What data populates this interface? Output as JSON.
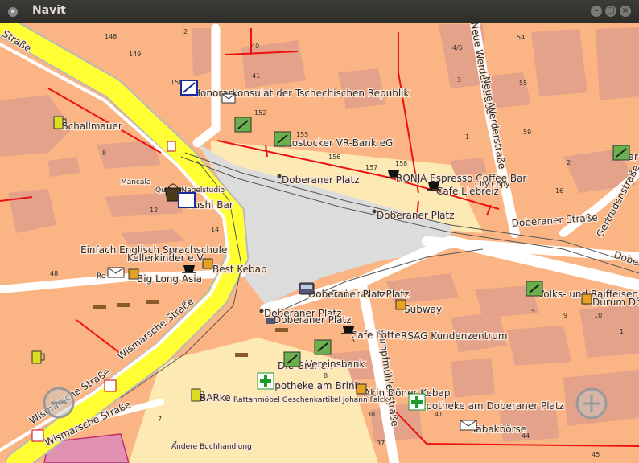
{
  "window": {
    "title": "Navit"
  },
  "labels": {
    "honorar": "Honorarkonsulat der Tschechischen Republik",
    "schallmauer": "Schallmauer",
    "rostocker": "Rostocker VR-Bank eG",
    "doberaner_platz_1": "Doberaner Platz",
    "doberaner_platz_2": "Doberaner Platz",
    "doberaner_platz_3": "Doberaner Platz",
    "doberaner_platz_4": "Doberaner Platz",
    "doberaner_platz_5": "Doberaner Platz",
    "doberaner_platz_6": "Doberaner Platz",
    "ronja": "RONJA Espresso Coffee Bar",
    "cafe_liebreiz": "Cafe Liebreiz",
    "city_copy": "City Copy",
    "mancala": "Mancala",
    "nagelstudio": "Queen Nagelstudio",
    "sushi_bar": "Sushi Bar",
    "englisch": "Einfach Englisch Sprachschule",
    "kellerkinder": "Kellerkinder e.V.",
    "best_kebap": "Best Kebap",
    "big_long_asia": "Big Long Asia",
    "rosa": "Ro",
    "subway": "Subway",
    "cafe_lotte": "Cafe Lotte",
    "rsag": "RSAG Kundenzentrum",
    "volksbank": "Volks- und Raiffeisenbank",
    "doener_bude": "Dürum Döner",
    "gruenen": "Die Grünen",
    "reinsbank": "Vereinsbank",
    "apotheke_brink": "Apotheke am Brink",
    "akin": "Akin Döner Kebap",
    "apotheke_platz": "Apotheke am Doberaner Platz",
    "tabakboerse": "Tabakbörse",
    "barke": "BARke",
    "rattanmoebel": "Rattanmöbel Geschenkartikel Johann Falck",
    "buchhandlung": "Andere Buchhandlung",
    "sarb": "Sar"
  },
  "streets": {
    "strasse_nw": "Straße",
    "neue_werder_1": "Neue Werderstraße",
    "neue_werder_2": "Neue Werderstraße",
    "doberaner_strasse": "Doberaner Straße",
    "doberaner_strasse_2": "Dobe",
    "gertruden": "Gertrudenstraße",
    "wismarsche_1": "Wismarsche Straße",
    "wismarsche_2": "Wismarsche Straße",
    "wismarsche_3": "Wismarsche Straße",
    "wismarsche_4": "Wismarsche Straße",
    "schoenfeldt": "Schröderstraße",
    "sumpfmuehle": "Sumpfmühlenstraße"
  },
  "house_numbers": {
    "n148": "148",
    "n149": "149",
    "n150": "150",
    "n2a": "2",
    "n40": "40",
    "n41": "41",
    "n152": "152",
    "n155": "155",
    "n156": "156",
    "n157": "157",
    "n158": "158",
    "n4_5": "4/5",
    "n3": "3",
    "n1": "1",
    "n54": "54",
    "n55": "55",
    "n59": "59",
    "n2b": "2",
    "n8": "8",
    "n12": "12",
    "n14": "14",
    "n48": "48",
    "n16": "16",
    "n6": "6",
    "n5": "5",
    "n9": "9",
    "n10": "10",
    "n1b": "1",
    "n3b": "3",
    "n7": "7",
    "n8b": "8",
    "n38": "38",
    "n37": "37",
    "n41b": "41",
    "n7b": "7",
    "n44": "44",
    "n45": "45"
  },
  "controls": {
    "zoom_out": "−",
    "zoom_in": "+"
  },
  "colors": {
    "building": "#e3a289",
    "land": "#fbb584",
    "primary_road": "#ffff33",
    "plaza": "#dcdcdc",
    "tram": "#ee1111"
  }
}
